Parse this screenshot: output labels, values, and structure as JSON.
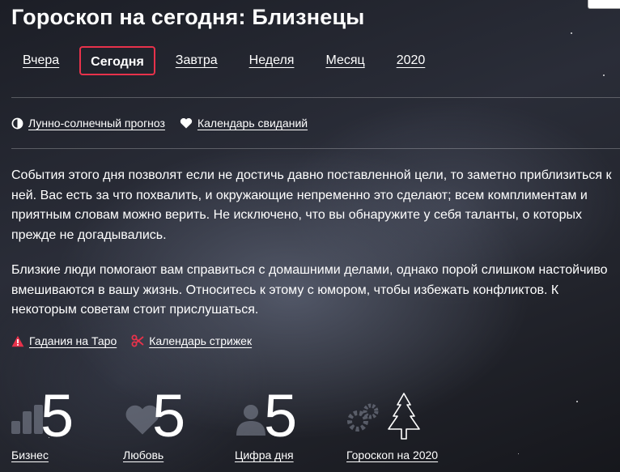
{
  "page": {
    "title": "Гороскоп на сегодня: Близнецы"
  },
  "tabs": [
    {
      "label": "Вчера",
      "active": false
    },
    {
      "label": "Сегодня",
      "active": true
    },
    {
      "label": "Завтра",
      "active": false
    },
    {
      "label": "Неделя",
      "active": false
    },
    {
      "label": "Месяц",
      "active": false
    },
    {
      "label": "2020",
      "active": false
    }
  ],
  "top_links": {
    "lunar": {
      "label": "Лунно-солнечный прогноз",
      "icon": "half-moon-icon"
    },
    "dating": {
      "label": "Календарь свиданий",
      "icon": "heart-icon"
    }
  },
  "forecast": {
    "p1": "События этого дня позволят если не достичь давно поставленной цели, то заметно приблизиться к ней. Вас есть за что похвалить, и окружающие непременно это сделают; всем комплиментам и приятным словам можно верить. Не исключено, что вы обнаружите у себя таланты, о которых прежде не догадывались.",
    "p2": "Близкие люди помогают вам справиться с домашними делами, однако порой слишком настойчиво вмешиваются в вашу жизнь. Относитесь к этому с юмором, чтобы избежать конфликтов. К некоторым советам стоит прислушаться."
  },
  "bottom_links": {
    "tarot": {
      "label": "Гадания на Таро",
      "icon": "triangle-icon",
      "color": "#e8324b"
    },
    "haircut": {
      "label": "Календарь стрижек",
      "icon": "scissors-icon",
      "color": "#e8324b"
    }
  },
  "stats": {
    "business": {
      "label": "Бизнес",
      "value": "5",
      "icon": "bar-chart-icon"
    },
    "love": {
      "label": "Любовь",
      "value": "5",
      "icon": "heart-icon"
    },
    "number": {
      "label": "Цифра дня",
      "value": "5",
      "icon": "person-icon"
    },
    "year": {
      "label": "Гороскоп на 2020",
      "icon": "christmas-tree-icon"
    }
  },
  "colors": {
    "accent": "#e8324b",
    "text": "#ffffff"
  }
}
